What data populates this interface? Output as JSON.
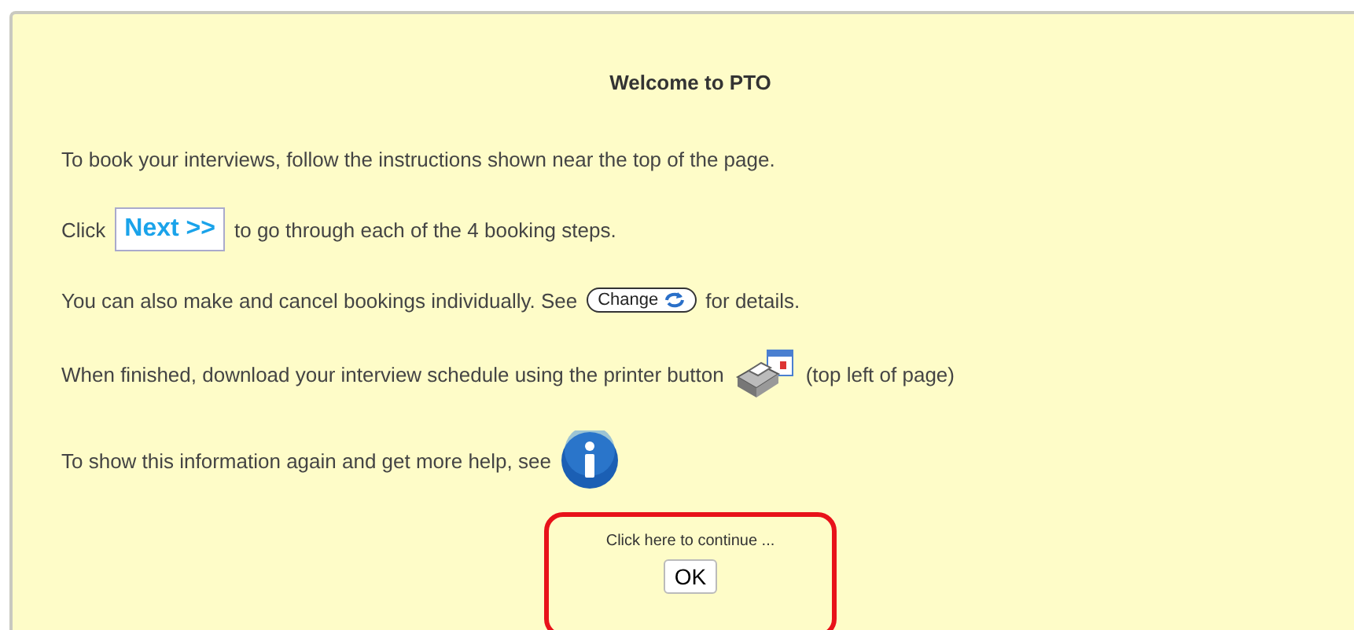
{
  "dialog": {
    "title": "Welcome to PTO",
    "lines": [
      {
        "segments": [
          {
            "kind": "text",
            "text": "To book your interviews, follow the instructions shown near the top of the page."
          }
        ]
      },
      {
        "segments": [
          {
            "kind": "text",
            "text": "Click"
          },
          {
            "kind": "next-button",
            "text": "Next >>"
          },
          {
            "kind": "text",
            "text": "to go through each of the 4 booking steps."
          }
        ]
      },
      {
        "segments": [
          {
            "kind": "text",
            "text": "You can also make and cancel bookings individually. See"
          },
          {
            "kind": "change-button",
            "text": "Change"
          },
          {
            "kind": "text",
            "text": "for details."
          }
        ]
      },
      {
        "segments": [
          {
            "kind": "text",
            "text": "When finished, download your interview schedule using the printer button"
          },
          {
            "kind": "printer-icon"
          },
          {
            "kind": "text",
            "text": "(top left of page)"
          }
        ]
      },
      {
        "segments": [
          {
            "kind": "text",
            "text": "To show this information again and get more help, see"
          },
          {
            "kind": "info-icon"
          }
        ]
      }
    ],
    "continue": {
      "prompt": "Click here to continue ...",
      "button": "OK"
    }
  }
}
